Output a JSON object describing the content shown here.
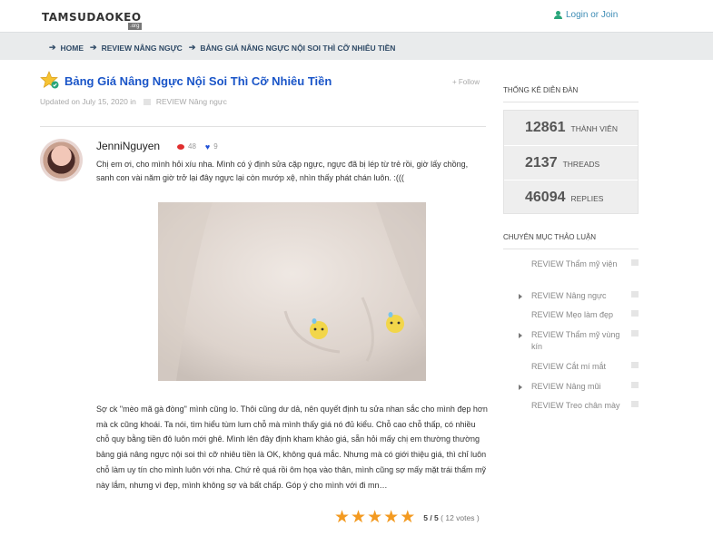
{
  "header": {
    "logo": "TAMSUDAOKEO",
    "logo_sub": ".org",
    "login": "Login or Join"
  },
  "breadcrumb": [
    "HOME",
    "REVIEW Nâng ngực",
    "BẢNG GIÁ NÂNG NGỰC NỘI SOI THÌ CỠ NHIÊU TIỀN"
  ],
  "thread": {
    "title": "Bảng Giá Nâng Ngực Nội Soi Thì Cỡ Nhiêu Tiền",
    "follow": "Follow",
    "updated": "Updated on July 15, 2020 in",
    "category": "REVIEW Nâng ngực"
  },
  "post": {
    "author": "JenniNguyen",
    "comments": "48",
    "likes": "9",
    "intro": "Chị em ơi, cho mình hỏi xíu nha. Mình có ý định sửa cặp ngực, ngực đã bị lép từ trẻ rồi, giờ lấy chồng, sanh con vài năm giờ trở lại đây ngực lại còn mướp xệ, nhìn thấy phát chán luôn. :(((",
    "body": "Sợ ck \"mèo mã gà đòng\" mình cũng lo. Thôi cũng dư dả, nên quyết định tu sửa nhan sắc cho mình đẹp hơn mà ck cũng khoái. Ta nói, tìm hiểu tùm lum chỗ mà mình thấy giá nó đủ kiểu. Chỗ cao chỗ thấp, có nhiều chỗ quy bằng tiền đô luôn mới ghê. Mình lên đây định kham khảo giá, sẵn hỏi mấy chị em thường thường bảng giá nâng ngực nội soi thì cỡ nhiêu tiền là OK, không quá mắc. Nhưng mà có giới thiệu giá, thì chỉ luôn chỗ làm uy tín cho mình luôn với nha. Chứ rẻ quá rồi ôm họa vào thân, mình cũng sợ mấy mặt trái thẩm mỹ này lắm, nhưng vì đẹp, mình không sợ và bất chấp. Góp ý cho mình với đi mn…",
    "rating_score": "5 / 5",
    "rating_votes": "( 12 votes )",
    "stars": 5
  },
  "sidebar": {
    "stats_title": "Thống kê diễn đàn",
    "stats": [
      {
        "value": "12861",
        "label": "Thành viên"
      },
      {
        "value": "2137",
        "label": "Threads"
      },
      {
        "value": "46094",
        "label": "Replies"
      }
    ],
    "categories_title": "Chuyên mục thảo luận",
    "categories": [
      {
        "label": "REVIEW Thẩm mỹ viện",
        "expandable": false
      },
      {
        "label": "REVIEW Nâng ngực",
        "expandable": true
      },
      {
        "label": "REVIEW Mẹo làm đẹp",
        "expandable": false
      },
      {
        "label": "REVIEW Thẩm mỹ vùng kín",
        "expandable": true
      },
      {
        "label": "REVIEW Cắt mí mắt",
        "expandable": false
      },
      {
        "label": "REVIEW Nâng mũi",
        "expandable": true
      },
      {
        "label": "REVIEW Treo chân mày",
        "expandable": false
      }
    ]
  },
  "colors": {
    "title_link": "#1a55c8",
    "login_link": "#3d8cb5",
    "rating_star": "#f39a21",
    "comment_icon": "#e02e2e",
    "heart_icon": "#1e4fd6"
  }
}
